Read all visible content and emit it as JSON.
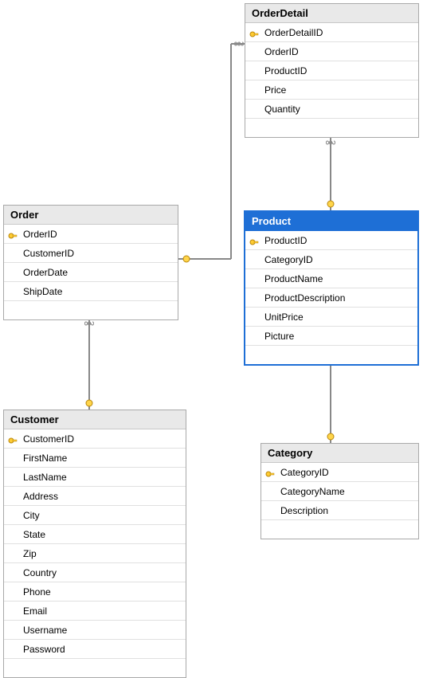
{
  "tables": {
    "orderdetail": {
      "title": "OrderDetail",
      "cols": [
        "OrderDetailID",
        "OrderID",
        "ProductID",
        "Price",
        "Quantity"
      ],
      "pk": [
        0
      ]
    },
    "order": {
      "title": "Order",
      "cols": [
        "OrderID",
        "CustomerID",
        "OrderDate",
        "ShipDate"
      ],
      "pk": [
        0
      ]
    },
    "product": {
      "title": "Product",
      "cols": [
        "ProductID",
        "CategoryID",
        "ProductName",
        "ProductDescription",
        "UnitPrice",
        "Picture"
      ],
      "pk": [
        0
      ]
    },
    "customer": {
      "title": "Customer",
      "cols": [
        "CustomerID",
        "FirstName",
        "LastName",
        "Address",
        "City",
        "State",
        "Zip",
        "Country",
        "Phone",
        "Email",
        "Username",
        "Password"
      ],
      "pk": [
        0
      ]
    },
    "category": {
      "title": "Category",
      "cols": [
        "CategoryID",
        "CategoryName",
        "Description"
      ],
      "pk": [
        0
      ]
    }
  }
}
